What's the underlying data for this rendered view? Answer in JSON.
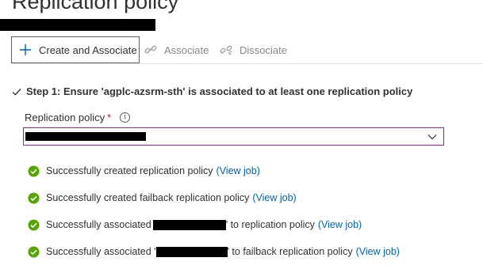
{
  "page": {
    "title": "Replication policy"
  },
  "toolbar": {
    "create_associate": "Create and Associate",
    "associate": "Associate",
    "dissociate": "Dissociate"
  },
  "step": {
    "text": "Step 1: Ensure 'agplc-azsrm-sth' is associated to at least one replication policy"
  },
  "field": {
    "label": "Replication policy",
    "required_marker": "*",
    "info_glyph": "i",
    "icon": "chevron-down-icon"
  },
  "status_items": [
    {
      "before": "Successfully created replication policy",
      "after": "",
      "link": "(View job)"
    },
    {
      "before": "Successfully created failback replication policy",
      "after": "",
      "link": "(View job)"
    },
    {
      "before": "Successfully associated ",
      "after": "' to replication policy",
      "link": "(View job)"
    },
    {
      "before": "Successfully associated '",
      "after": "' to failback replication policy",
      "link": "(View job)"
    }
  ],
  "colors": {
    "accent": "#0063b1",
    "success": "#57a300",
    "focus_border": "#8a2a8f",
    "required": "#a4262c"
  }
}
